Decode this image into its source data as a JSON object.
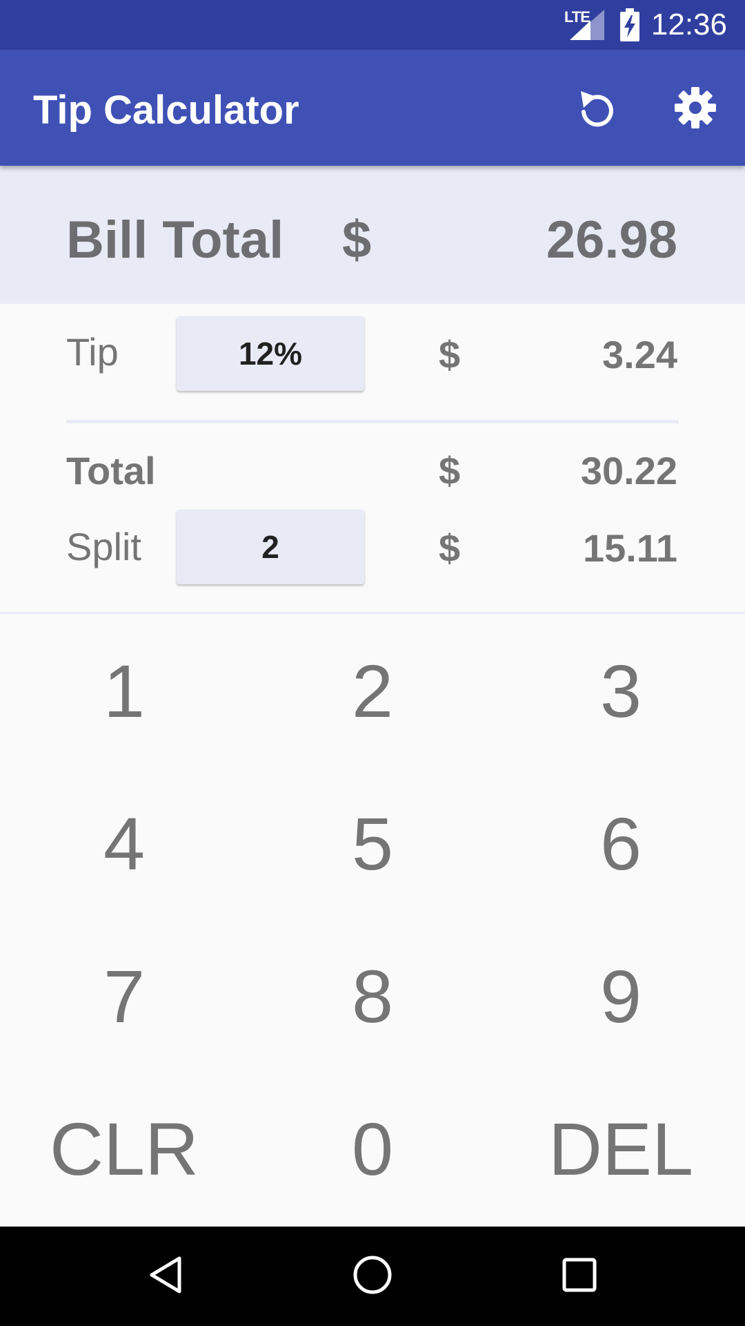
{
  "status_bar": {
    "network": "LTE",
    "time": "12:36",
    "icons": [
      "lte-icon",
      "signal-icon",
      "battery-charging-icon"
    ]
  },
  "app_bar": {
    "title": "Tip Calculator",
    "actions": [
      "reset-icon",
      "settings-icon"
    ]
  },
  "bill": {
    "label": "Bill Total",
    "currency": "$",
    "amount": "26.98"
  },
  "tip": {
    "label": "Tip",
    "percent": "12%",
    "currency": "$",
    "amount": "3.24"
  },
  "total": {
    "label": "Total",
    "currency": "$",
    "amount": "30.22"
  },
  "split": {
    "label": "Split",
    "count": "2",
    "currency": "$",
    "amount": "15.11"
  },
  "keypad": {
    "keys": [
      "1",
      "2",
      "3",
      "4",
      "5",
      "6",
      "7",
      "8",
      "9",
      "CLR",
      "0",
      "DEL"
    ]
  },
  "nav_bar": {
    "buttons": [
      "back-icon",
      "home-icon",
      "recents-icon"
    ]
  },
  "colors": {
    "status_bar": "#303f9f",
    "app_bar": "#3f51b5",
    "panel": "#e8eaf6",
    "text_gray": "#757575",
    "background": "#fafafa"
  }
}
